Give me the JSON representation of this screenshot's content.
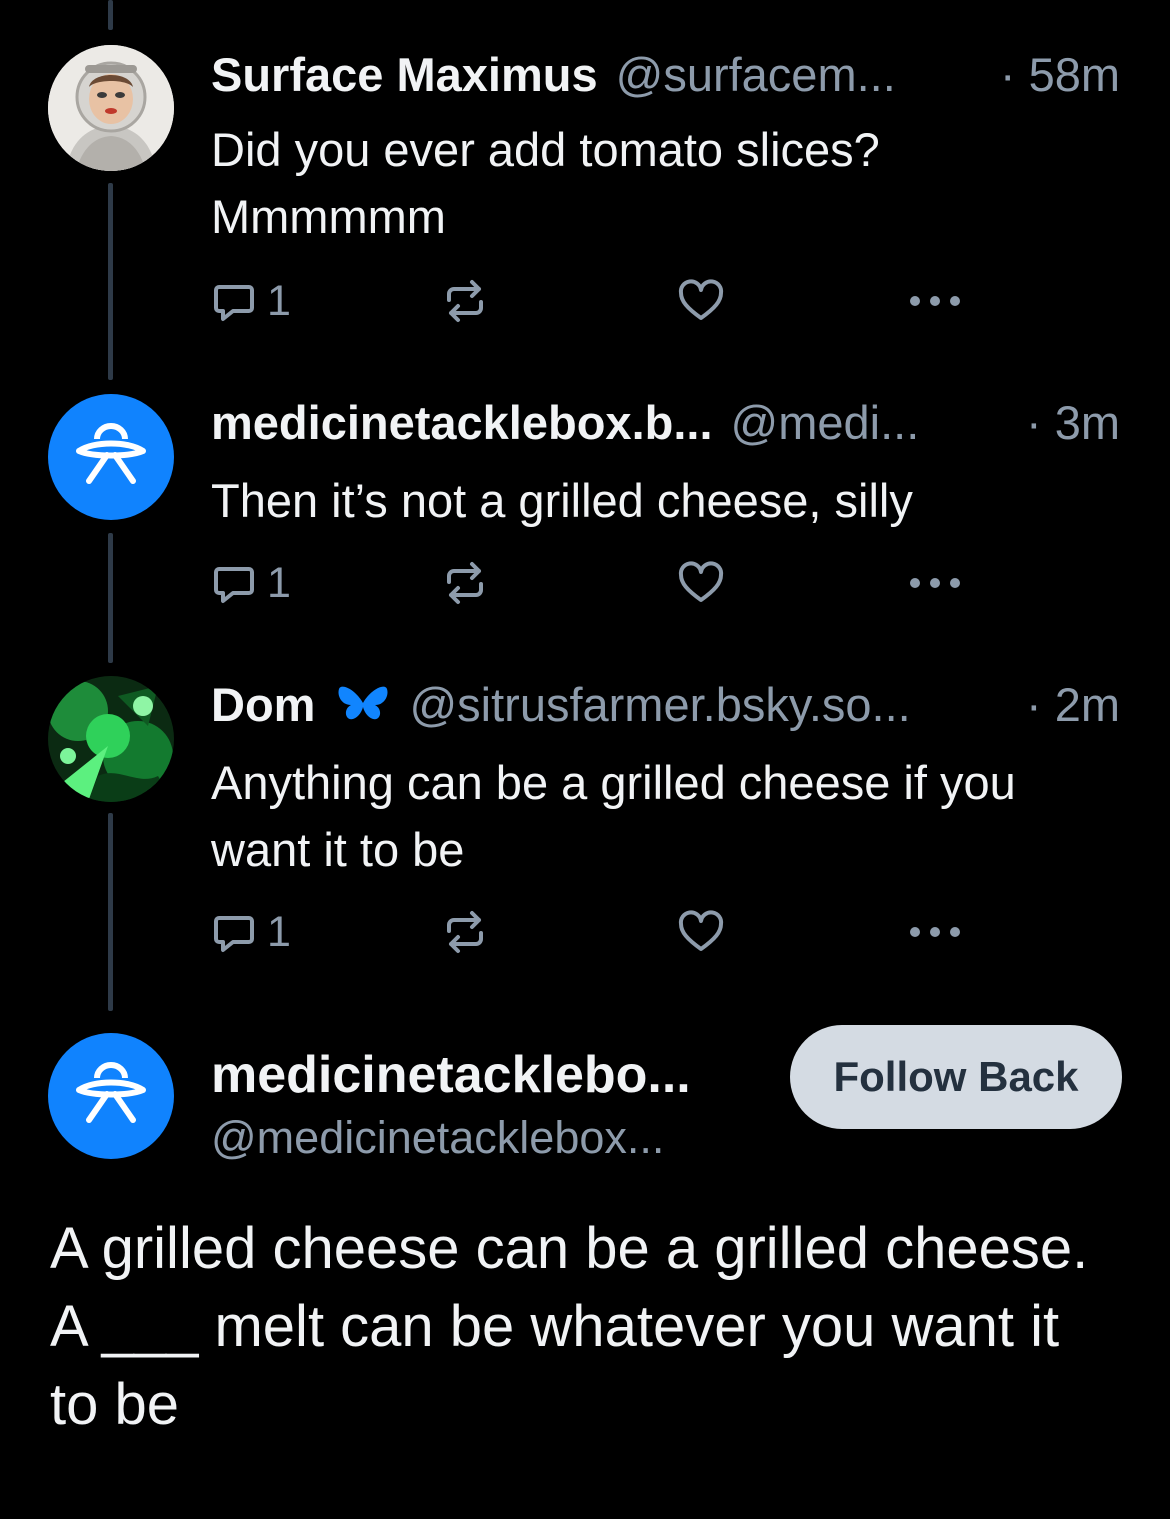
{
  "posts": [
    {
      "name": "Surface Maximus",
      "handle": "@surfacem...",
      "time": "· 58m",
      "text": "Did you ever add tomato slices? Mmmmmm",
      "reply_count": "1",
      "avatar": "astronaut-avatar"
    },
    {
      "name": "medicinetacklebox.b...",
      "handle": "@medi...",
      "time": "· 3m",
      "text": "Then it’s not a grilled cheese, silly",
      "reply_count": "1",
      "avatar": "default-avatar"
    },
    {
      "name": "Dom",
      "name_emoji": "butterfly-icon",
      "handle": "@sitrusfarmer.bsky.so...",
      "time": "· 2m",
      "text": "Anything can be a grilled cheese if you want it to be",
      "reply_count": "1",
      "avatar": "green-photo-avatar"
    }
  ],
  "main_post": {
    "name": "medicinetacklebo...",
    "handle": "@medicinetacklebox...",
    "follow_label": "Follow Back",
    "text": "A grilled cheese can be a grilled cheese. A ___ melt can be whatever you want it to be",
    "avatar": "default-avatar"
  },
  "icons": [
    "reply-icon",
    "repost-icon",
    "like-icon",
    "more-icon"
  ],
  "colors": {
    "background": "#000000",
    "text": "#f1f3f5",
    "muted": "#8d9bab",
    "avatar_blue": "#1083fe",
    "button_bg": "#d4dbe3",
    "button_text": "#24313f",
    "thread_line": "#2e3a48",
    "butterfly": "#1185fe"
  }
}
